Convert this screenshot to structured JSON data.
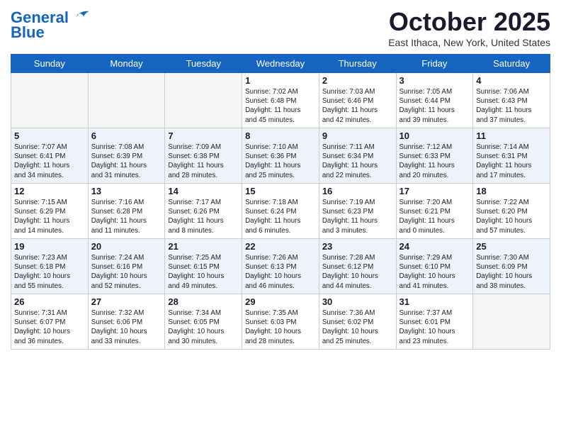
{
  "header": {
    "logo_line1": "General",
    "logo_line2": "Blue",
    "month": "October 2025",
    "location": "East Ithaca, New York, United States"
  },
  "weekdays": [
    "Sunday",
    "Monday",
    "Tuesday",
    "Wednesday",
    "Thursday",
    "Friday",
    "Saturday"
  ],
  "weeks": [
    [
      {
        "day": "",
        "info": ""
      },
      {
        "day": "",
        "info": ""
      },
      {
        "day": "",
        "info": ""
      },
      {
        "day": "1",
        "info": "Sunrise: 7:02 AM\nSunset: 6:48 PM\nDaylight: 11 hours\nand 45 minutes."
      },
      {
        "day": "2",
        "info": "Sunrise: 7:03 AM\nSunset: 6:46 PM\nDaylight: 11 hours\nand 42 minutes."
      },
      {
        "day": "3",
        "info": "Sunrise: 7:05 AM\nSunset: 6:44 PM\nDaylight: 11 hours\nand 39 minutes."
      },
      {
        "day": "4",
        "info": "Sunrise: 7:06 AM\nSunset: 6:43 PM\nDaylight: 11 hours\nand 37 minutes."
      }
    ],
    [
      {
        "day": "5",
        "info": "Sunrise: 7:07 AM\nSunset: 6:41 PM\nDaylight: 11 hours\nand 34 minutes."
      },
      {
        "day": "6",
        "info": "Sunrise: 7:08 AM\nSunset: 6:39 PM\nDaylight: 11 hours\nand 31 minutes."
      },
      {
        "day": "7",
        "info": "Sunrise: 7:09 AM\nSunset: 6:38 PM\nDaylight: 11 hours\nand 28 minutes."
      },
      {
        "day": "8",
        "info": "Sunrise: 7:10 AM\nSunset: 6:36 PM\nDaylight: 11 hours\nand 25 minutes."
      },
      {
        "day": "9",
        "info": "Sunrise: 7:11 AM\nSunset: 6:34 PM\nDaylight: 11 hours\nand 22 minutes."
      },
      {
        "day": "10",
        "info": "Sunrise: 7:12 AM\nSunset: 6:33 PM\nDaylight: 11 hours\nand 20 minutes."
      },
      {
        "day": "11",
        "info": "Sunrise: 7:14 AM\nSunset: 6:31 PM\nDaylight: 11 hours\nand 17 minutes."
      }
    ],
    [
      {
        "day": "12",
        "info": "Sunrise: 7:15 AM\nSunset: 6:29 PM\nDaylight: 11 hours\nand 14 minutes."
      },
      {
        "day": "13",
        "info": "Sunrise: 7:16 AM\nSunset: 6:28 PM\nDaylight: 11 hours\nand 11 minutes."
      },
      {
        "day": "14",
        "info": "Sunrise: 7:17 AM\nSunset: 6:26 PM\nDaylight: 11 hours\nand 8 minutes."
      },
      {
        "day": "15",
        "info": "Sunrise: 7:18 AM\nSunset: 6:24 PM\nDaylight: 11 hours\nand 6 minutes."
      },
      {
        "day": "16",
        "info": "Sunrise: 7:19 AM\nSunset: 6:23 PM\nDaylight: 11 hours\nand 3 minutes."
      },
      {
        "day": "17",
        "info": "Sunrise: 7:20 AM\nSunset: 6:21 PM\nDaylight: 11 hours\nand 0 minutes."
      },
      {
        "day": "18",
        "info": "Sunrise: 7:22 AM\nSunset: 6:20 PM\nDaylight: 10 hours\nand 57 minutes."
      }
    ],
    [
      {
        "day": "19",
        "info": "Sunrise: 7:23 AM\nSunset: 6:18 PM\nDaylight: 10 hours\nand 55 minutes."
      },
      {
        "day": "20",
        "info": "Sunrise: 7:24 AM\nSunset: 6:16 PM\nDaylight: 10 hours\nand 52 minutes."
      },
      {
        "day": "21",
        "info": "Sunrise: 7:25 AM\nSunset: 6:15 PM\nDaylight: 10 hours\nand 49 minutes."
      },
      {
        "day": "22",
        "info": "Sunrise: 7:26 AM\nSunset: 6:13 PM\nDaylight: 10 hours\nand 46 minutes."
      },
      {
        "day": "23",
        "info": "Sunrise: 7:28 AM\nSunset: 6:12 PM\nDaylight: 10 hours\nand 44 minutes."
      },
      {
        "day": "24",
        "info": "Sunrise: 7:29 AM\nSunset: 6:10 PM\nDaylight: 10 hours\nand 41 minutes."
      },
      {
        "day": "25",
        "info": "Sunrise: 7:30 AM\nSunset: 6:09 PM\nDaylight: 10 hours\nand 38 minutes."
      }
    ],
    [
      {
        "day": "26",
        "info": "Sunrise: 7:31 AM\nSunset: 6:07 PM\nDaylight: 10 hours\nand 36 minutes."
      },
      {
        "day": "27",
        "info": "Sunrise: 7:32 AM\nSunset: 6:06 PM\nDaylight: 10 hours\nand 33 minutes."
      },
      {
        "day": "28",
        "info": "Sunrise: 7:34 AM\nSunset: 6:05 PM\nDaylight: 10 hours\nand 30 minutes."
      },
      {
        "day": "29",
        "info": "Sunrise: 7:35 AM\nSunset: 6:03 PM\nDaylight: 10 hours\nand 28 minutes."
      },
      {
        "day": "30",
        "info": "Sunrise: 7:36 AM\nSunset: 6:02 PM\nDaylight: 10 hours\nand 25 minutes."
      },
      {
        "day": "31",
        "info": "Sunrise: 7:37 AM\nSunset: 6:01 PM\nDaylight: 10 hours\nand 23 minutes."
      },
      {
        "day": "",
        "info": ""
      }
    ]
  ]
}
